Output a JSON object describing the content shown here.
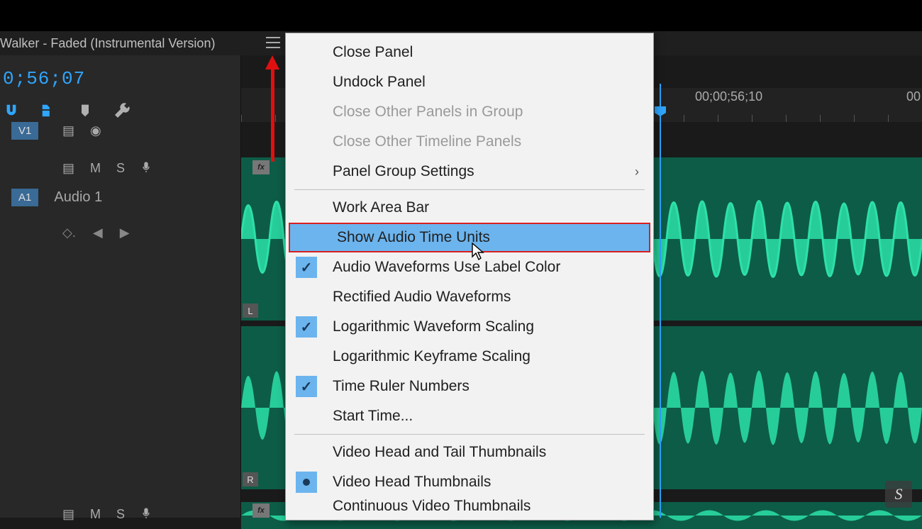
{
  "tab": {
    "title": "Walker - Faded (Instrumental Version)"
  },
  "timecode": "0;56;07",
  "ruler": {
    "label1": "00;00;56;10",
    "label2": "00"
  },
  "tracks": {
    "v1": "V1",
    "a1": "A1",
    "audio1_label": "Audio 1",
    "mute": "M",
    "solo": "S",
    "keyframe": "◇.",
    "prev": "◀",
    "next": "▶",
    "left_ch": "L",
    "right_ch": "R",
    "fx": "fx"
  },
  "menu": {
    "items": [
      {
        "label": "Close Panel",
        "enabled": true
      },
      {
        "label": "Undock Panel",
        "enabled": true
      },
      {
        "label": "Close Other Panels in Group",
        "enabled": false
      },
      {
        "label": "Close Other Timeline Panels",
        "enabled": false
      },
      {
        "label": "Panel Group Settings",
        "enabled": true,
        "submenu": true
      }
    ],
    "items2": [
      {
        "label": "Work Area Bar",
        "checked": false
      },
      {
        "label": "Show Audio Time Units",
        "highlighted": true
      },
      {
        "label": "Audio Waveforms Use Label Color",
        "checked": true
      },
      {
        "label": "Rectified Audio Waveforms",
        "checked": false
      },
      {
        "label": "Logarithmic Waveform Scaling",
        "checked": true
      },
      {
        "label": "Logarithmic Keyframe Scaling",
        "checked": false
      },
      {
        "label": "Time Ruler Numbers",
        "checked": true
      },
      {
        "label": "Start Time...",
        "checked": false
      }
    ],
    "items3": [
      {
        "label": "Video Head and Tail Thumbnails"
      },
      {
        "label": "Video Head Thumbnails",
        "radio": true
      },
      {
        "label": "Continuous Video Thumbnails"
      }
    ]
  },
  "watermark": "S"
}
